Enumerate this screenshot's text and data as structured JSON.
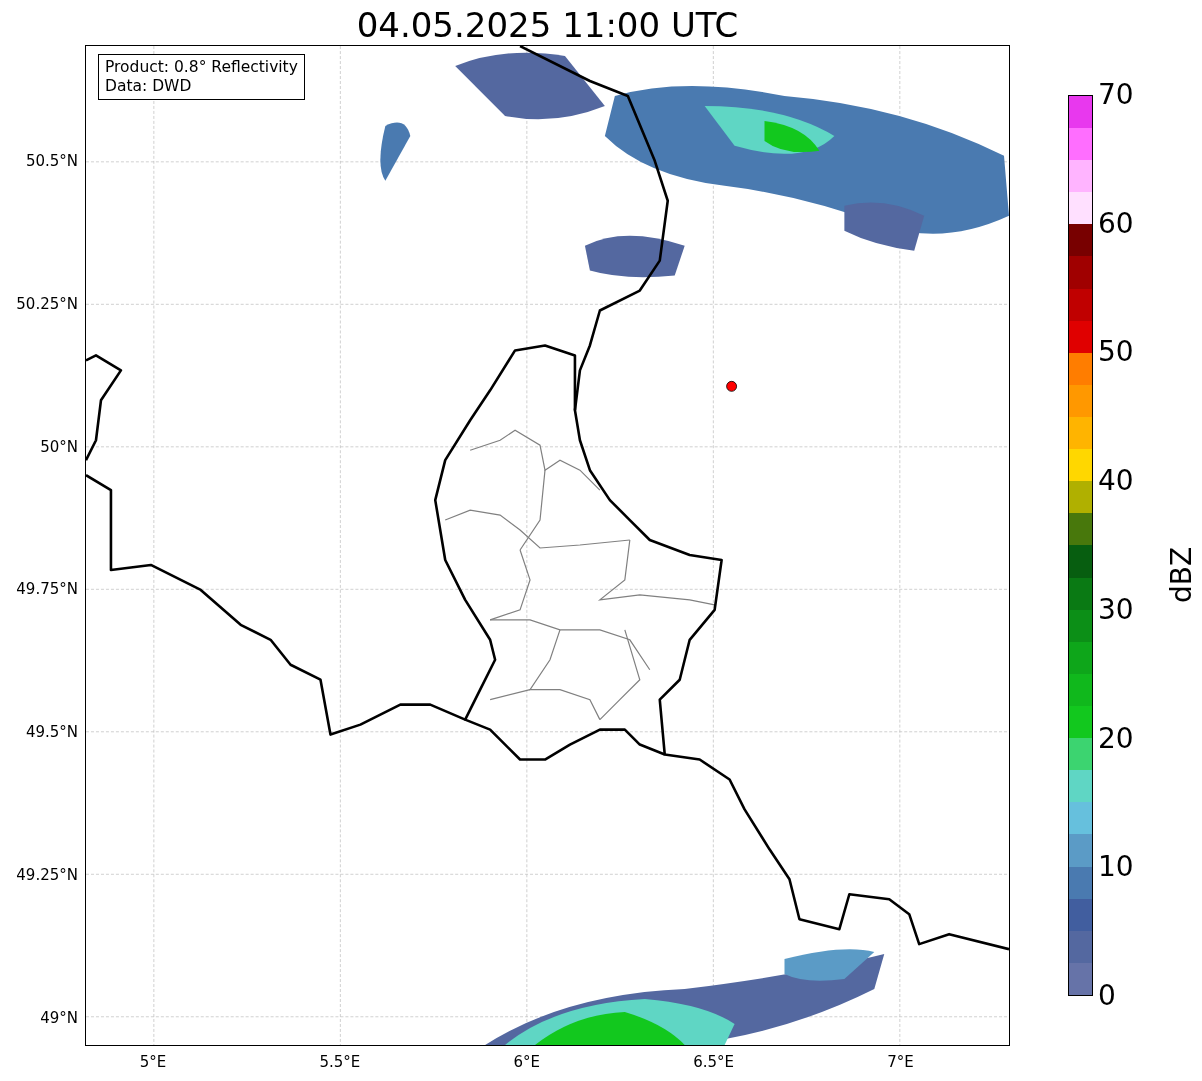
{
  "title": "04.05.2025 11:00 UTC",
  "legend": {
    "lines": [
      "Product: 0.8° Reflectivity",
      "Data: DWD"
    ]
  },
  "map": {
    "xticks": [
      "5°E",
      "5.5°E",
      "6°E",
      "6.5°E",
      "7°E"
    ],
    "yticks": [
      "50.5°N",
      "50.25°N",
      "50°N",
      "49.75°N",
      "49.5°N",
      "49.25°N",
      "49°N"
    ],
    "marker": {
      "color": "#ff0000"
    }
  },
  "colorbar": {
    "label": "dBZ",
    "ticks": [
      "70",
      "60",
      "50",
      "40",
      "30",
      "20",
      "10",
      "0"
    ],
    "segments": [
      {
        "color": "#6673a8"
      },
      {
        "color": "#5468a0"
      },
      {
        "color": "#415e9f"
      },
      {
        "color": "#4a7ab0"
      },
      {
        "color": "#5b9bc6"
      },
      {
        "color": "#66c0dd"
      },
      {
        "color": "#5fd6c4"
      },
      {
        "color": "#3cd470"
      },
      {
        "color": "#12c81e"
      },
      {
        "color": "#10b81c"
      },
      {
        "color": "#0ea61a"
      },
      {
        "color": "#0c8f17"
      },
      {
        "color": "#0a7a14"
      },
      {
        "color": "#075e10"
      },
      {
        "color": "#48780c"
      },
      {
        "color": "#b0b000"
      },
      {
        "color": "#ffd700"
      },
      {
        "color": "#ffb400"
      },
      {
        "color": "#ff9800"
      },
      {
        "color": "#ff7d00"
      },
      {
        "color": "#e00000"
      },
      {
        "color": "#c00000"
      },
      {
        "color": "#a00000"
      },
      {
        "color": "#780000"
      },
      {
        "color": "#ffe0ff"
      },
      {
        "color": "#ffb4ff"
      },
      {
        "color": "#ff6eff"
      },
      {
        "color": "#e838ee"
      }
    ]
  }
}
